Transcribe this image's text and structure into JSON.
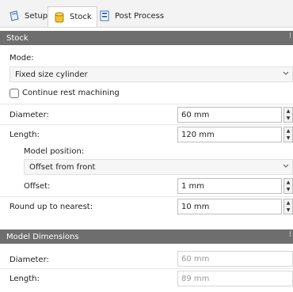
{
  "tabs": [
    {
      "label": "Setup",
      "icon": "setup-icon"
    },
    {
      "label": "Stock",
      "icon": "stock-icon"
    },
    {
      "label": "Post Process",
      "icon": "post-process-icon"
    }
  ],
  "stock": {
    "header": "Stock",
    "mode_label": "Mode:",
    "mode_value": "Fixed size cylinder",
    "continue_rest_label": "Continue rest machining",
    "diameter_label": "Diameter:",
    "diameter_value": "60 mm",
    "length_label": "Length:",
    "length_value": "120 mm",
    "model_position_label": "Model position:",
    "model_position_value": "Offset from front",
    "offset_label": "Offset:",
    "offset_value": "1 mm",
    "round_up_label": "Round up to nearest:",
    "round_up_value": "10 mm"
  },
  "model_dimensions": {
    "header": "Model Dimensions",
    "diameter_label": "Diameter:",
    "diameter_value": "60 mm",
    "length_label": "Length:",
    "length_value": "89 mm"
  },
  "colors": {
    "section_header": "#6e6e6e",
    "stock_icon": "#f2c12e",
    "post_icon": "#3b6fb6"
  }
}
